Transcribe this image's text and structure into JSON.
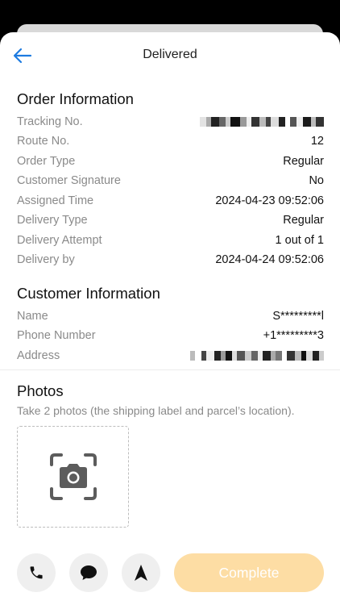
{
  "header": {
    "title": "Delivered"
  },
  "order": {
    "title": "Order Information",
    "rows": [
      {
        "label": "Tracking No.",
        "value": ""
      },
      {
        "label": "Route No.",
        "value": "12"
      },
      {
        "label": "Order Type",
        "value": "Regular"
      },
      {
        "label": "Customer Signature",
        "value": "No"
      },
      {
        "label": "Assigned Time",
        "value": "2024-04-23 09:52:06"
      },
      {
        "label": "Delivery Type",
        "value": "Regular"
      },
      {
        "label": "Delivery Attempt",
        "value": "1 out of 1"
      },
      {
        "label": "Delivery by",
        "value": "2024-04-24 09:52:06"
      }
    ]
  },
  "customer": {
    "title": "Customer Information",
    "rows": [
      {
        "label": "Name",
        "value": "S*********l"
      },
      {
        "label": "Phone Number",
        "value": "+1*********3"
      },
      {
        "label": "Address",
        "value": ""
      }
    ]
  },
  "photos": {
    "title": "Photos",
    "subtitle": "Take 2 photos (the shipping label and parcel’s location)."
  },
  "actions": {
    "complete_label": "Complete"
  },
  "icons": {
    "back": "arrow-left-icon",
    "camera": "camera-scan-icon",
    "phone": "phone-icon",
    "message": "chat-bubble-icon",
    "navigate": "navigation-arrow-icon"
  },
  "colors": {
    "accent": "#1e7be0",
    "complete_bg": "#fddda4",
    "label_gray": "#8a8a8a"
  }
}
